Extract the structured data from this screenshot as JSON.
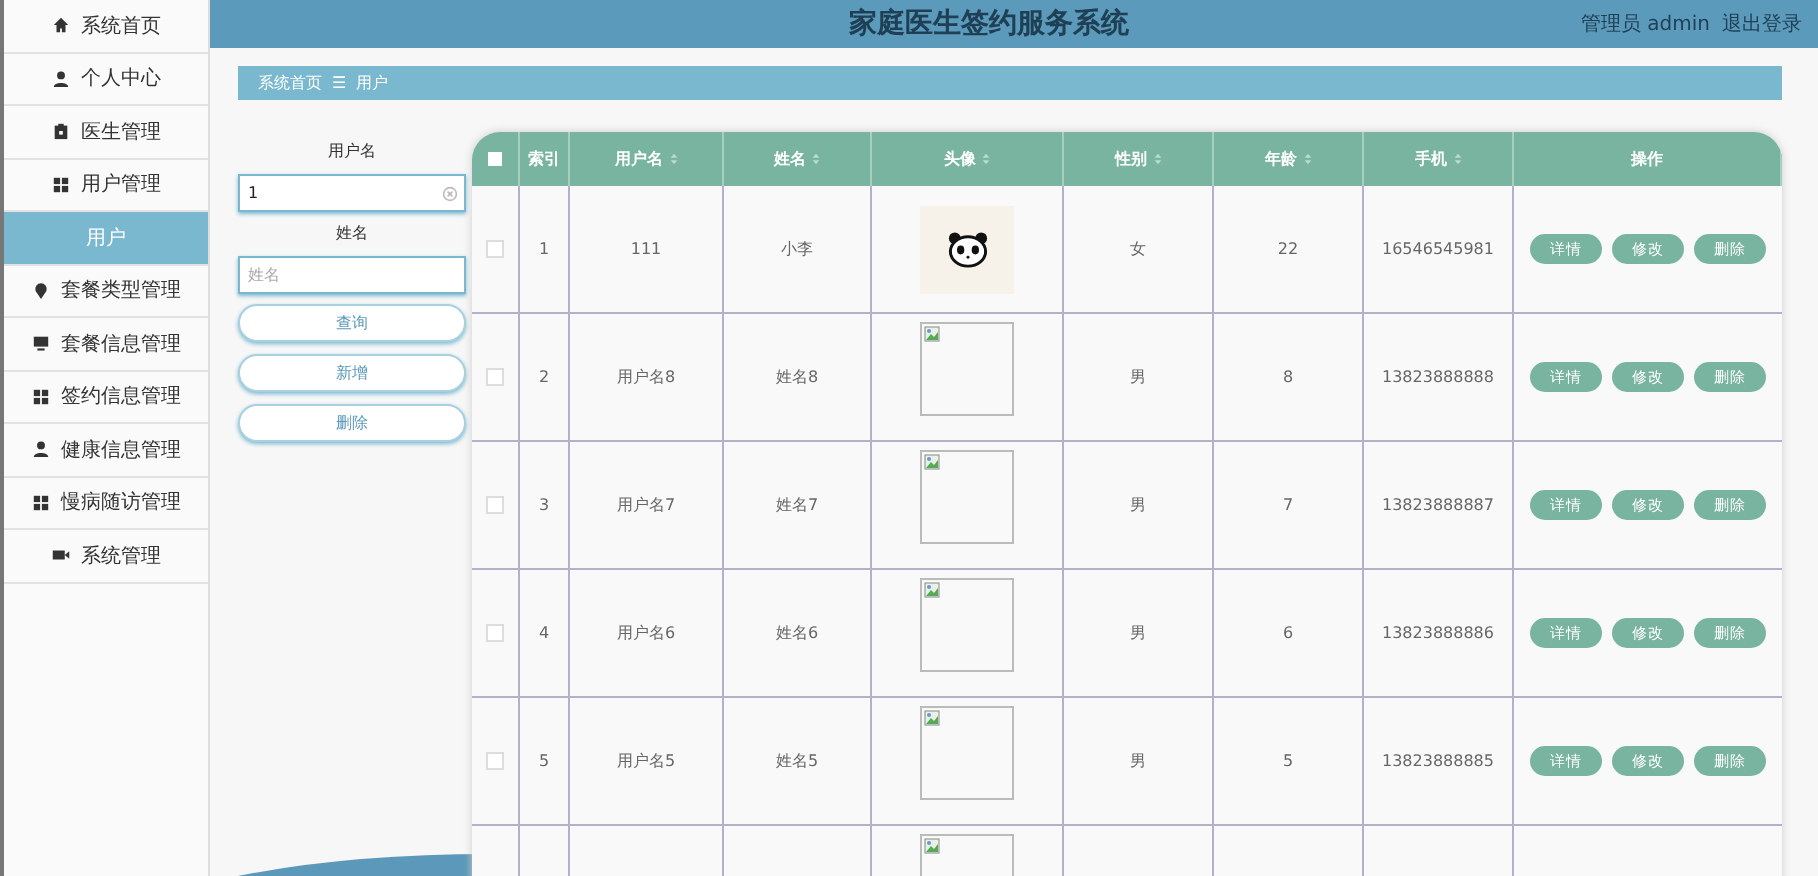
{
  "sidebar": {
    "items": [
      {
        "label": "系统首页",
        "selected": false
      },
      {
        "label": "个人中心",
        "selected": false
      },
      {
        "label": "医生管理",
        "selected": false
      },
      {
        "label": "用户管理",
        "selected": false
      },
      {
        "label": "用户",
        "selected": true
      },
      {
        "label": "套餐类型管理",
        "selected": false
      },
      {
        "label": "套餐信息管理",
        "selected": false
      },
      {
        "label": "签约信息管理",
        "selected": false
      },
      {
        "label": "健康信息管理",
        "selected": false
      },
      {
        "label": "慢病随访管理",
        "selected": false
      },
      {
        "label": "系统管理",
        "selected": false
      }
    ]
  },
  "header": {
    "title": "家庭医生签约服务系统",
    "user": "管理员 admin",
    "logout": "退出登录"
  },
  "breadcrumb": {
    "home": "系统首页",
    "separator": "☰",
    "current": "用户"
  },
  "search": {
    "fields": [
      {
        "label": "用户名",
        "value": "1"
      },
      {
        "label": "姓名",
        "placeholder": "姓名"
      }
    ],
    "buttons": [
      "查询",
      "新增",
      "删除"
    ]
  },
  "table": {
    "all_checked": false,
    "columns": [
      {
        "label": "索引",
        "sortable": false
      },
      {
        "label": "用户名",
        "sortable": true
      },
      {
        "label": "姓名",
        "sortable": true
      },
      {
        "label": "头像",
        "sortable": true
      },
      {
        "label": "性别",
        "sortable": true
      },
      {
        "label": "年龄",
        "sortable": true
      },
      {
        "label": "手机",
        "sortable": true
      },
      {
        "label": "操作",
        "sortable": false
      }
    ],
    "rows": [
      {
        "checked": false,
        "index": "1",
        "username": "111",
        "name": "小李",
        "gender": "女",
        "age": "22",
        "phone": "16546545981",
        "actions": [
          "详情",
          "修改",
          "删除"
        ]
      },
      {
        "checked": false,
        "index": "2",
        "username": "用户名8",
        "name": "姓名8",
        "gender": "男",
        "age": "8",
        "phone": "13823888888",
        "actions": [
          "详情",
          "修改",
          "删除"
        ]
      },
      {
        "checked": false,
        "index": "3",
        "username": "用户名7",
        "name": "姓名7",
        "gender": "男",
        "age": "7",
        "phone": "13823888887",
        "actions": [
          "详情",
          "修改",
          "删除"
        ]
      },
      {
        "checked": false,
        "index": "4",
        "username": "用户名6",
        "name": "姓名6",
        "gender": "男",
        "age": "6",
        "phone": "13823888886",
        "actions": [
          "详情",
          "修改",
          "删除"
        ]
      },
      {
        "checked": false,
        "index": "5",
        "username": "用户名5",
        "name": "姓名5",
        "gender": "男",
        "age": "5",
        "phone": "13823888885",
        "actions": [
          "详情",
          "修改",
          "删除"
        ]
      }
    ]
  }
}
